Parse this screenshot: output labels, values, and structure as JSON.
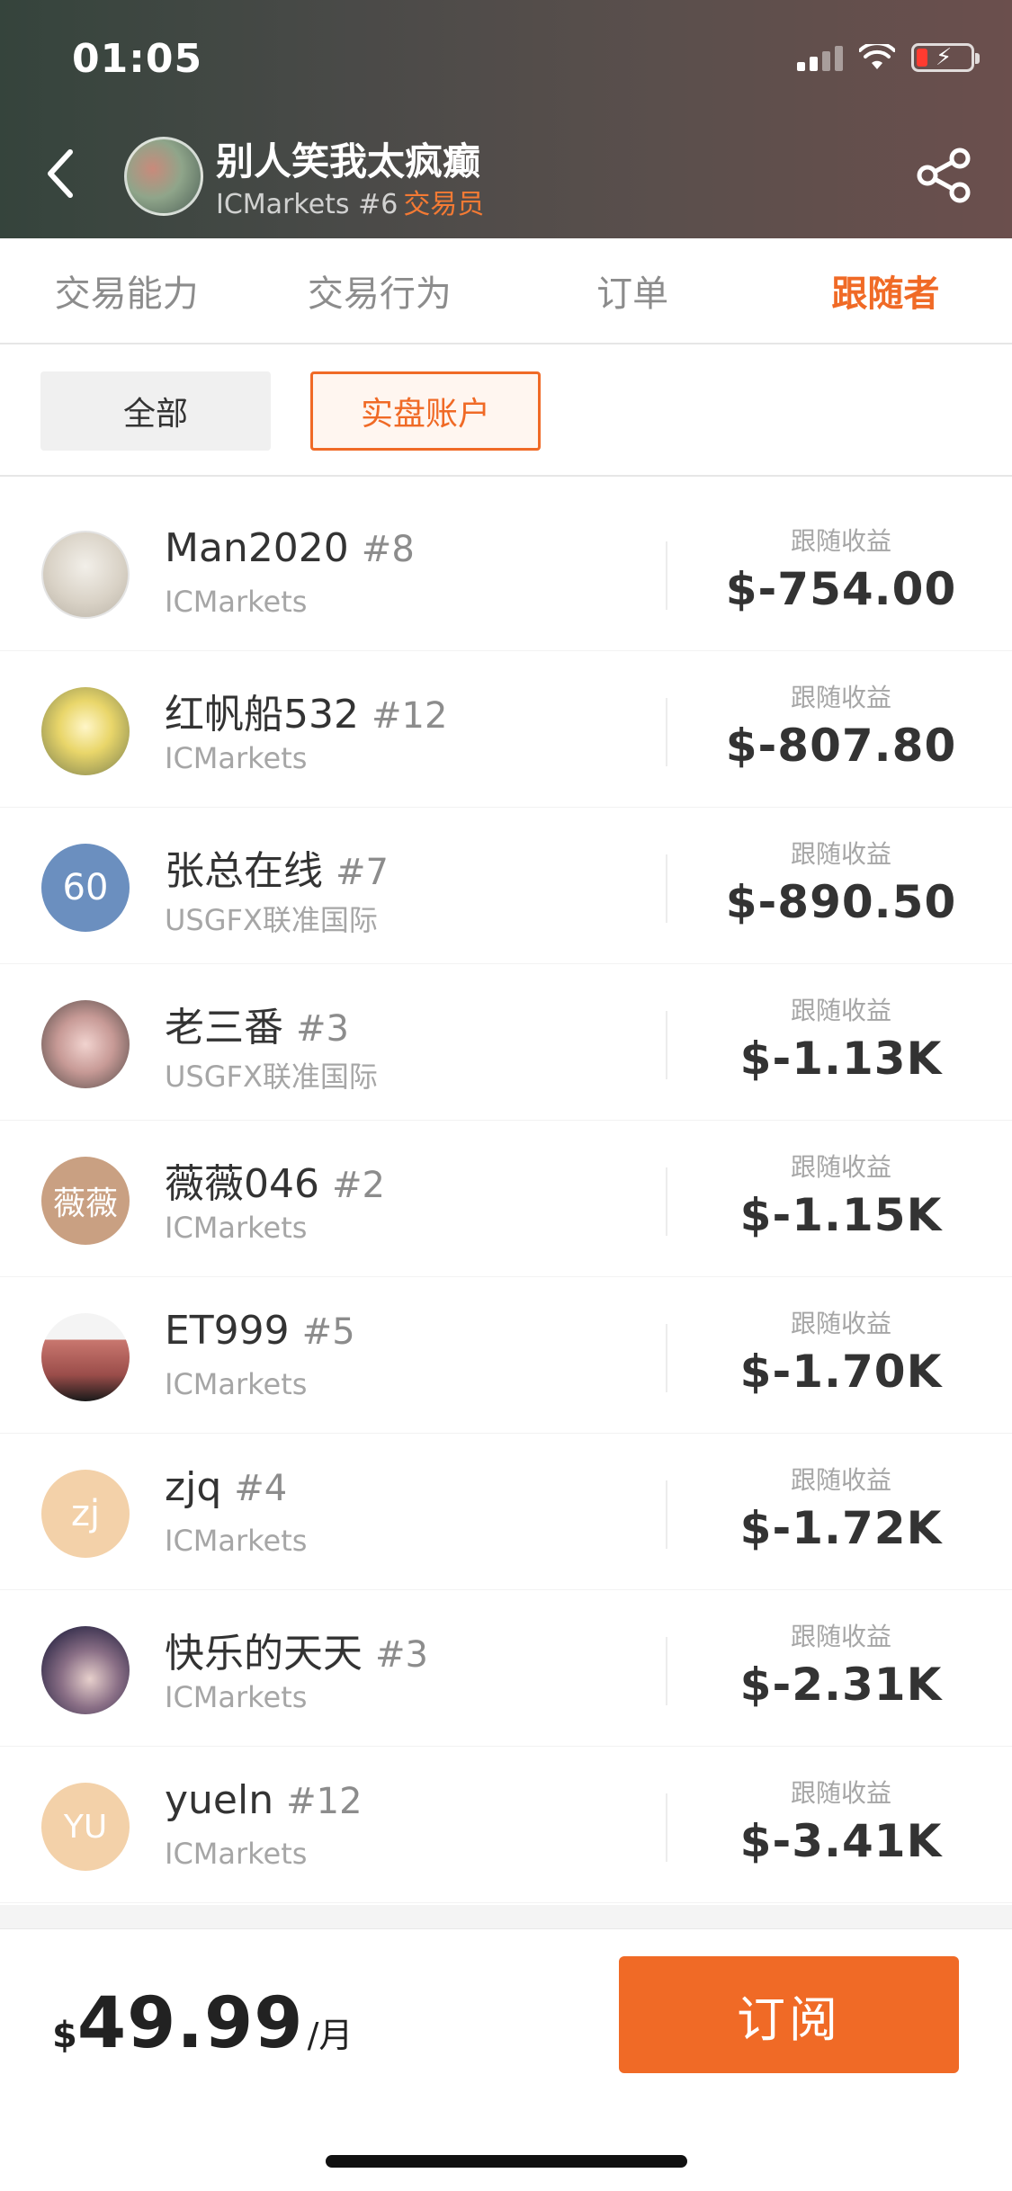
{
  "status": {
    "time": "01:05",
    "icons": [
      "signal-icon",
      "wifi-icon",
      "battery-icon"
    ]
  },
  "header": {
    "trader_name": "别人笑我太疯癫",
    "broker_rank": "ICMarkets #6",
    "role": "交易员",
    "icons": [
      "back-icon",
      "share-icon"
    ]
  },
  "tabs": [
    {
      "label": "交易能力"
    },
    {
      "label": "交易行为"
    },
    {
      "label": "订单"
    },
    {
      "label": "跟随者"
    }
  ],
  "filters": {
    "all": "全部",
    "real": "实盘账户"
  },
  "followers": [
    {
      "name": "Man2020",
      "rank": "#8",
      "broker": "ICMarkets",
      "earn_label": "跟随收益",
      "earn": "$-754.00",
      "avatar_text": ""
    },
    {
      "name": "红帆船532",
      "rank": "#12",
      "broker": "ICMarkets",
      "earn_label": "跟随收益",
      "earn": "$-807.80",
      "avatar_text": ""
    },
    {
      "name": "张总在线",
      "rank": "#7",
      "broker": "USGFX联准国际",
      "earn_label": "跟随收益",
      "earn": "$-890.50",
      "avatar_text": "60"
    },
    {
      "name": "老三番",
      "rank": "#3",
      "broker": "USGFX联准国际",
      "earn_label": "跟随收益",
      "earn": "$-1.13K",
      "avatar_text": ""
    },
    {
      "name": "薇薇046",
      "rank": "#2",
      "broker": "ICMarkets",
      "earn_label": "跟随收益",
      "earn": "$-1.15K",
      "avatar_text": "薇薇"
    },
    {
      "name": "ET999",
      "rank": "#5",
      "broker": "ICMarkets",
      "earn_label": "跟随收益",
      "earn": "$-1.70K",
      "avatar_text": ""
    },
    {
      "name": "zjq",
      "rank": "#4",
      "broker": "ICMarkets",
      "earn_label": "跟随收益",
      "earn": "$-1.72K",
      "avatar_text": "zj"
    },
    {
      "name": "快乐的天天",
      "rank": "#3",
      "broker": "ICMarkets",
      "earn_label": "跟随收益",
      "earn": "$-2.31K",
      "avatar_text": ""
    },
    {
      "name": "yueln",
      "rank": "#12",
      "broker": "ICMarkets",
      "earn_label": "跟随收益",
      "earn": "$-3.41K",
      "avatar_text": "YU"
    }
  ],
  "subscription": {
    "currency": "$",
    "amount": "49.99",
    "period": "/月",
    "button": "订阅"
  },
  "colors": {
    "accent": "#f06a26",
    "text": "#333333",
    "muted": "#a6a6a6"
  }
}
